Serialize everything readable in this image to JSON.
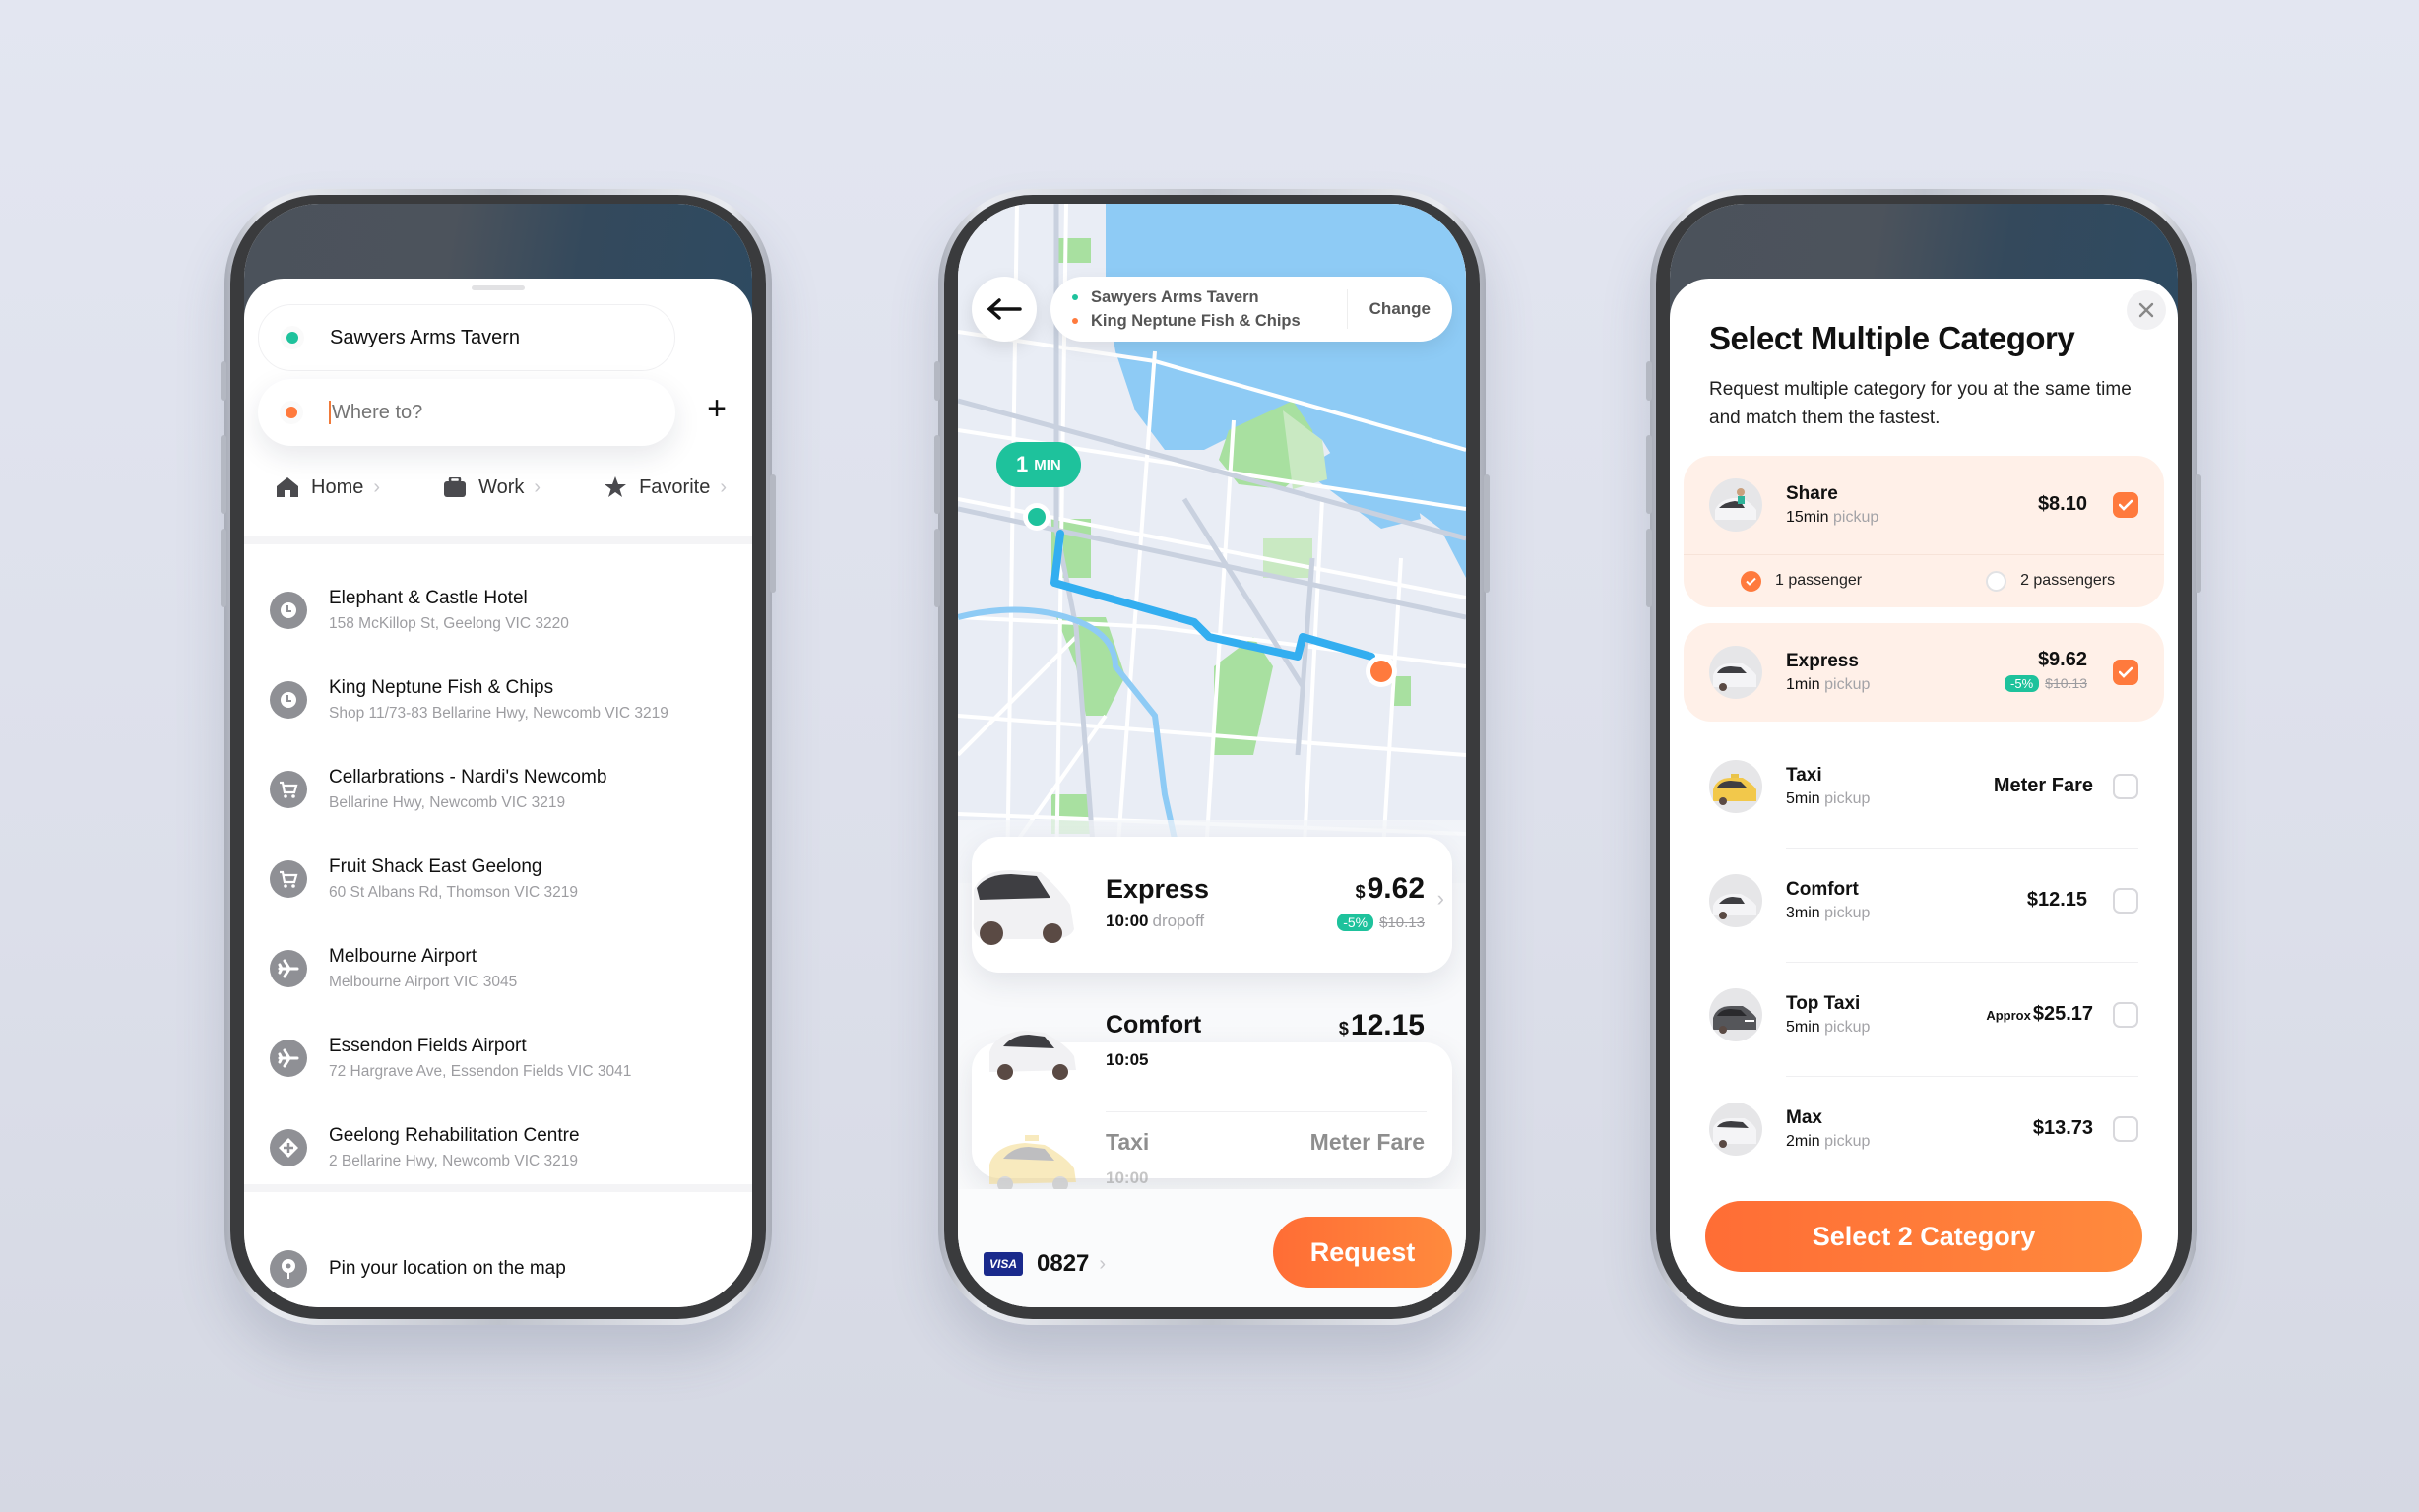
{
  "colors": {
    "accent_orange": "#ff7a3d",
    "accent_green": "#1ec29c",
    "icon_gray": "#8f9095"
  },
  "search_screen": {
    "pickup": "Sawyers Arms Tavern",
    "destination_placeholder": "Where to?",
    "destination_value": "",
    "add_stop_label": "+",
    "shortcuts": [
      {
        "label": "Home",
        "icon": "home-icon"
      },
      {
        "label": "Work",
        "icon": "briefcase-icon"
      },
      {
        "label": "Favorite",
        "icon": "star-icon"
      }
    ],
    "places": [
      {
        "title": "Elephant & Castle Hotel",
        "address": "158 McKillop St, Geelong VIC 3220",
        "icon": "clock-icon"
      },
      {
        "title": "King Neptune Fish & Chips",
        "address": "Shop 11/73-83 Bellarine Hwy, Newcomb VIC 3219",
        "icon": "clock-icon"
      },
      {
        "title": "Cellarbrations - Nardi's Newcomb",
        "address": "Bellarine Hwy, Newcomb VIC 3219",
        "icon": "cart-icon"
      },
      {
        "title": "Fruit Shack East Geelong",
        "address": "60 St Albans Rd, Thomson VIC 3219",
        "icon": "cart-icon"
      },
      {
        "title": "Melbourne Airport",
        "address": "Melbourne Airport VIC 3045",
        "icon": "airplane-icon"
      },
      {
        "title": "Essendon Fields Airport",
        "address": "72 Hargrave Ave, Essendon Fields VIC 3041",
        "icon": "airplane-icon"
      },
      {
        "title": "Geelong Rehabilitation Centre",
        "address": "2 Bellarine Hwy, Newcomb VIC 3219",
        "icon": "medical-icon"
      }
    ],
    "pin_label": "Pin your location on the map"
  },
  "ride_screen": {
    "route": {
      "from": "Sawyers Arms Tavern",
      "to": "King Neptune Fish & Chips",
      "change_label": "Change"
    },
    "eta": {
      "value": "1",
      "unit": "MIN"
    },
    "rides": [
      {
        "name": "Express",
        "time": "10:00",
        "time_suffix": "dropoff",
        "currency": "$",
        "price": "9.62",
        "discount": "-5%",
        "original_price": "$10.13",
        "selected": true
      },
      {
        "name": "Comfort",
        "time": "10:05",
        "currency": "$",
        "price": "12.15"
      },
      {
        "name": "Taxi",
        "time": "10:00",
        "price_text": "Meter Fare"
      }
    ],
    "payment": {
      "brand": "VISA",
      "last4": "0827"
    },
    "request_label": "Request"
  },
  "category_screen": {
    "title": "Select Multiple Category",
    "description": "Request multiple category for you at the same time and match them the fastest.",
    "categories": [
      {
        "name": "Share",
        "eta": "15min",
        "eta_suffix": "pickup",
        "price": "$8.10",
        "checked": true
      },
      {
        "name": "Express",
        "eta": "1min",
        "eta_suffix": "pickup",
        "price": "$9.62",
        "discount": "-5%",
        "original_price": "$10.13",
        "checked": true
      },
      {
        "name": "Taxi",
        "eta": "5min",
        "eta_suffix": "pickup",
        "price": "Meter Fare",
        "checked": false
      },
      {
        "name": "Comfort",
        "eta": "3min",
        "eta_suffix": "pickup",
        "price": "$12.15",
        "checked": false
      },
      {
        "name": "Top Taxi",
        "eta": "5min",
        "eta_suffix": "pickup",
        "price_prefix": "Approx",
        "price": "$25.17",
        "checked": false
      },
      {
        "name": "Max",
        "eta": "2min",
        "eta_suffix": "pickup",
        "price": "$13.73",
        "checked": false
      }
    ],
    "passenger_options": [
      {
        "label": "1 passenger",
        "selected": true
      },
      {
        "label": "2 passengers",
        "selected": false
      }
    ],
    "confirm_label": "Select 2 Category"
  }
}
